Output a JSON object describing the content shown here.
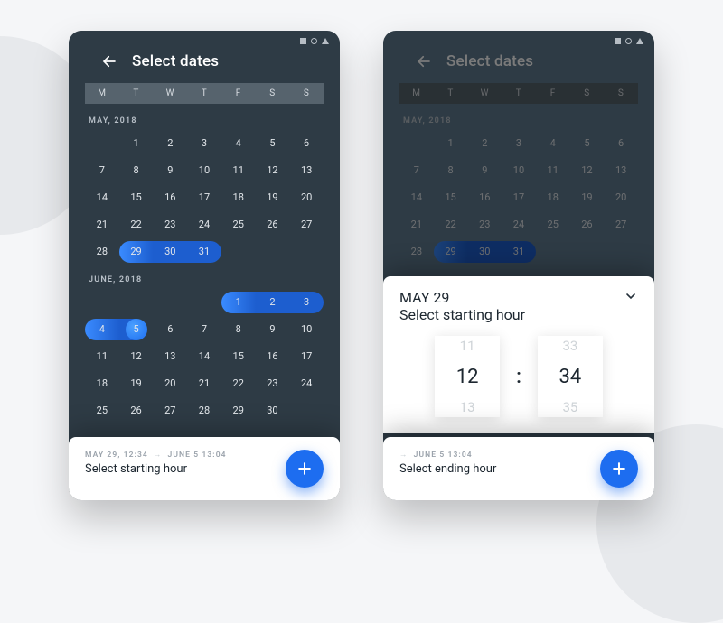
{
  "header": {
    "title": "Select dates"
  },
  "dow": [
    "M",
    "T",
    "W",
    "T",
    "F",
    "S",
    "S"
  ],
  "months": {
    "may": {
      "label": "MAY, 2018",
      "leading_blanks": 1,
      "days": 31,
      "range_start": 29,
      "range_end": 31
    },
    "june": {
      "label": "JUNE, 2018",
      "leading_blanks": 4,
      "days": 30,
      "range1_start": 1,
      "range1_end": 3,
      "range2_start": 4,
      "cap_day": 5
    }
  },
  "left_sheet": {
    "meta_from": "MAY 29, 12:34",
    "meta_to": "JUNE 5 13:04",
    "title": "Select starting hour"
  },
  "right_time_sheet": {
    "meta": "MAY 29",
    "title": "Select starting hour",
    "hour_prev": "11",
    "hour": "12",
    "hour_next": "13",
    "min_prev": "33",
    "min": "34",
    "min_next": "35"
  },
  "right_sheet": {
    "meta_to": "JUNE 5 13:04",
    "title": "Select ending hour"
  },
  "colors": {
    "accent": "#1d6df0"
  }
}
